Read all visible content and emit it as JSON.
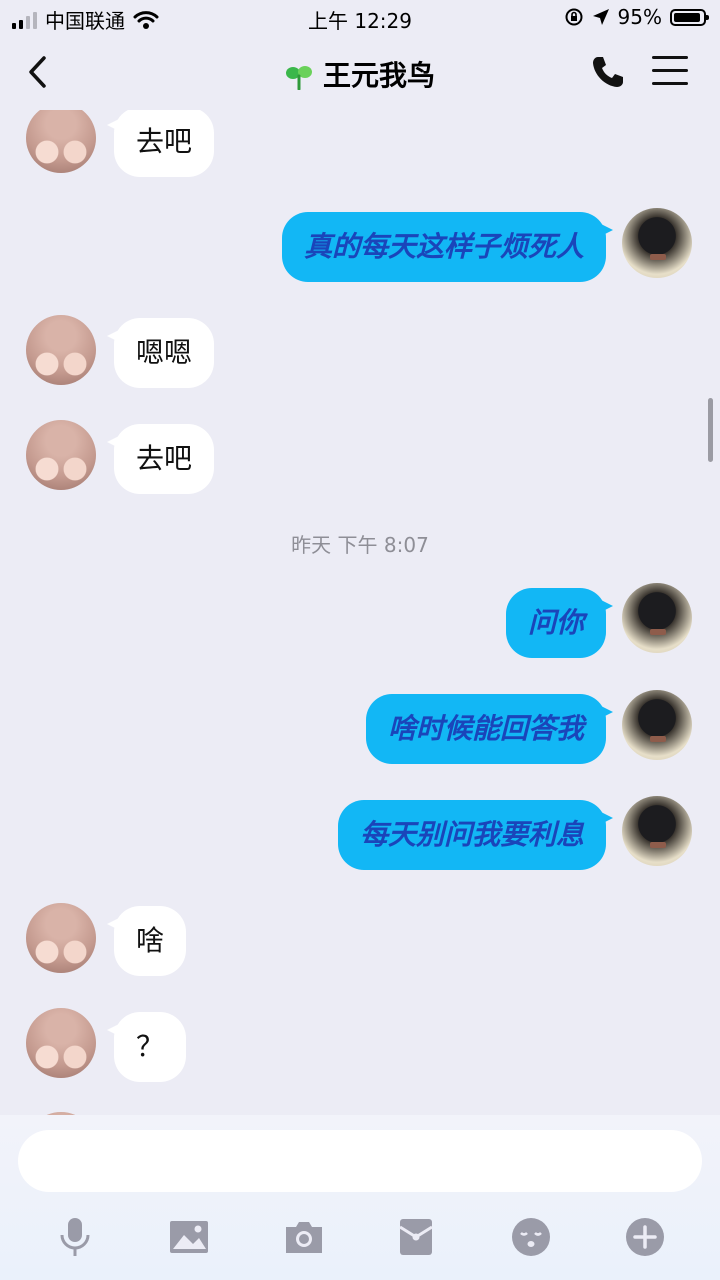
{
  "status_bar": {
    "carrier": "中国联通",
    "time": "上午 12:29",
    "battery": "95%"
  },
  "nav": {
    "title": "王元我鸟"
  },
  "chat": {
    "messages": [
      {
        "side": "in",
        "text": "去吧"
      },
      {
        "side": "out",
        "text": "真的每天这样子烦死人"
      },
      {
        "side": "in",
        "text": "嗯嗯"
      },
      {
        "side": "in",
        "text": "去吧"
      },
      {
        "side": "out",
        "text": "问你"
      },
      {
        "side": "out",
        "text": "啥时候能回答我"
      },
      {
        "side": "out",
        "text": "每天别问我要利息"
      },
      {
        "side": "in",
        "text": "啥"
      },
      {
        "side": "in",
        "text": "？"
      }
    ],
    "timestamp": "昨天  下午 8:07"
  },
  "input": {
    "value": "",
    "placeholder": ""
  },
  "toolbar": {
    "icons": [
      "microphone-icon",
      "image-icon",
      "camera-icon",
      "red-packet-icon",
      "emoji-icon",
      "plus-icon"
    ]
  },
  "colors": {
    "background": "#ececf5",
    "bubble_out": "#12b7f5",
    "bubble_out_text": "#1a45ba",
    "bubble_in": "#ffffff"
  }
}
